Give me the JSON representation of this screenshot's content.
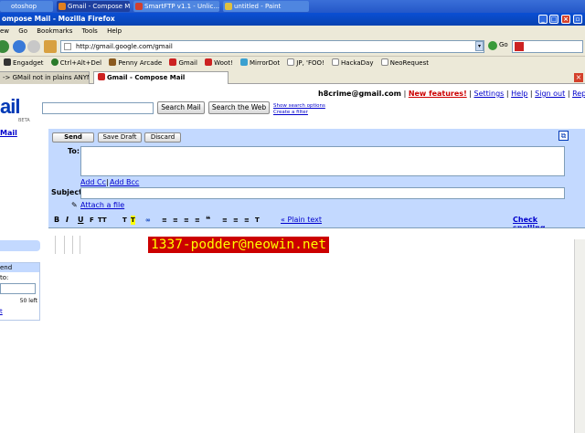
{
  "taskbar": {
    "items": [
      {
        "label": "otoshop",
        "color": "#4f86e0"
      },
      {
        "label": "Gmail - Compose Mail -...",
        "color": "#1e3f9e"
      },
      {
        "label": "SmartFTP v1.1 - Unlic...",
        "color": "#4f86e0"
      },
      {
        "label": "untitled - Paint",
        "color": "#4f86e0"
      }
    ]
  },
  "window": {
    "title": "ompose Mail - Mozilla Firefox"
  },
  "menu": {
    "items": [
      "ew",
      "Go",
      "Bookmarks",
      "Tools",
      "Help"
    ]
  },
  "nav": {
    "url": "http://gmail.google.com/gmail",
    "go_label": "Go"
  },
  "bookmarks": [
    {
      "label": "Engadget",
      "color": "#333"
    },
    {
      "label": "Ctrl+Alt+Del",
      "color": "#2a7a2a"
    },
    {
      "label": "Penny Arcade",
      "color": "#8a5a20"
    },
    {
      "label": "Gmail",
      "color": "#cc2222"
    },
    {
      "label": "Woot!",
      "color": "#cc2222"
    },
    {
      "label": "MirrorDot",
      "color": "#3aa0d0"
    },
    {
      "label": "JP, 'FOO!",
      "color": "#888"
    },
    {
      "label": "HackaDay",
      "color": "#888"
    },
    {
      "label": "NeoRequest",
      "color": "#888"
    }
  ],
  "tabs": [
    {
      "label": "-> GMail not in plains ANYMORE!"
    },
    {
      "label": "Gmail - Compose Mail"
    }
  ],
  "gmail": {
    "logo": "ail",
    "beta": "BETA",
    "search_mail": "Search Mail",
    "search_web": "Search the Web",
    "search_options": "Show search options",
    "create_filter": "Create a filter",
    "user_email": "h8crime@gmail.com",
    "sep": "|",
    "new_features": "New features!",
    "settings": "Settings",
    "help": "Help",
    "sign_out": "Sign out",
    "report_bug": "Report bug",
    "compose_link": "Mail",
    "invite": {
      "title": "end",
      "to": "to:",
      "left": "50 left",
      "link": "t"
    }
  },
  "compose": {
    "send": "Send",
    "save_draft": "Save Draft",
    "discard": "Discard",
    "to_label": "To:",
    "add_cc": "Add Cc",
    "add_bcc": "Add Bcc",
    "subject_label": "Subject:",
    "attach": "Attach a file",
    "plain_text": "« Plain text",
    "check_spelling": "Check spelling",
    "body_text": "1337-podder@neowin.net"
  }
}
